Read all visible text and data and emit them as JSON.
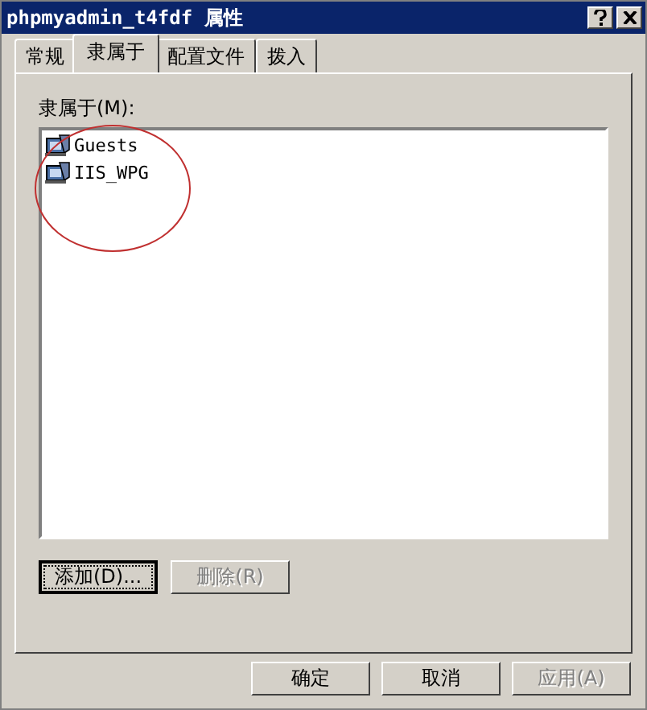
{
  "window": {
    "title": "phpmyadmin_t4fdf 属性"
  },
  "tabs": [
    {
      "label": "常规",
      "selected": false
    },
    {
      "label": "隶属于",
      "selected": true
    },
    {
      "label": "配置文件",
      "selected": false
    },
    {
      "label": "拨入",
      "selected": false
    }
  ],
  "member_of": {
    "label": "隶属于(M):",
    "items": [
      {
        "name": "Guests"
      },
      {
        "name": "IIS_WPG"
      }
    ]
  },
  "list_buttons": [
    {
      "label": "添加(D)...",
      "disabled": false,
      "focused": true
    },
    {
      "label": "删除(R)",
      "disabled": true,
      "focused": false
    }
  ],
  "buttons": [
    {
      "label": "确定",
      "disabled": false
    },
    {
      "label": "取消",
      "disabled": false
    },
    {
      "label": "应用(A)",
      "disabled": true
    }
  ]
}
